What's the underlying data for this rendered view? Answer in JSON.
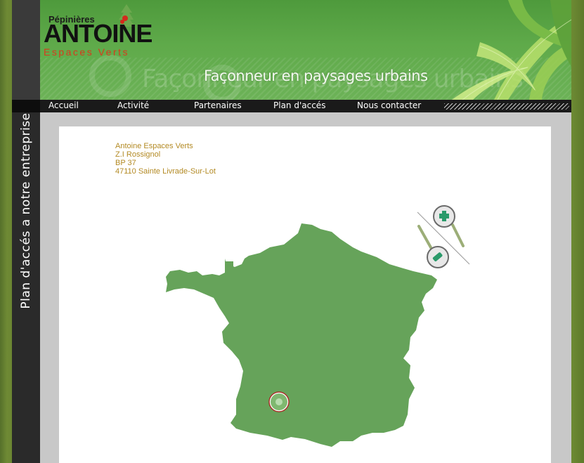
{
  "header": {
    "logo_small": "Pépinières",
    "logo_main": "ANTOINE",
    "logo_sub": "Espaces Verts",
    "slogan": "Façonneur en paysages urbains"
  },
  "nav": {
    "items": [
      {
        "label": "Accueil"
      },
      {
        "label": "Activité"
      },
      {
        "label": "Partenaires"
      },
      {
        "label": "Plan d'accés"
      },
      {
        "label": "Nous contacter"
      }
    ]
  },
  "sidebar": {
    "title": "Plan d'accés a notre entreprise"
  },
  "address": {
    "line1": "Antoine Espaces Verts",
    "line2": "Z.I Rossignol",
    "line3": "BP 37",
    "line4": "47110 Sainte Livrade-Sur-Lot"
  },
  "map": {
    "fill_color": "#66a35a",
    "marker_color": "#a8322a",
    "zoom_in_icon": "zoom-in-icon",
    "zoom_out_icon": "zoom-out-icon"
  },
  "colors": {
    "accent_text": "#b38a24",
    "nav_bg": "#1a1a1a",
    "banner_green": "#5faa4a"
  }
}
